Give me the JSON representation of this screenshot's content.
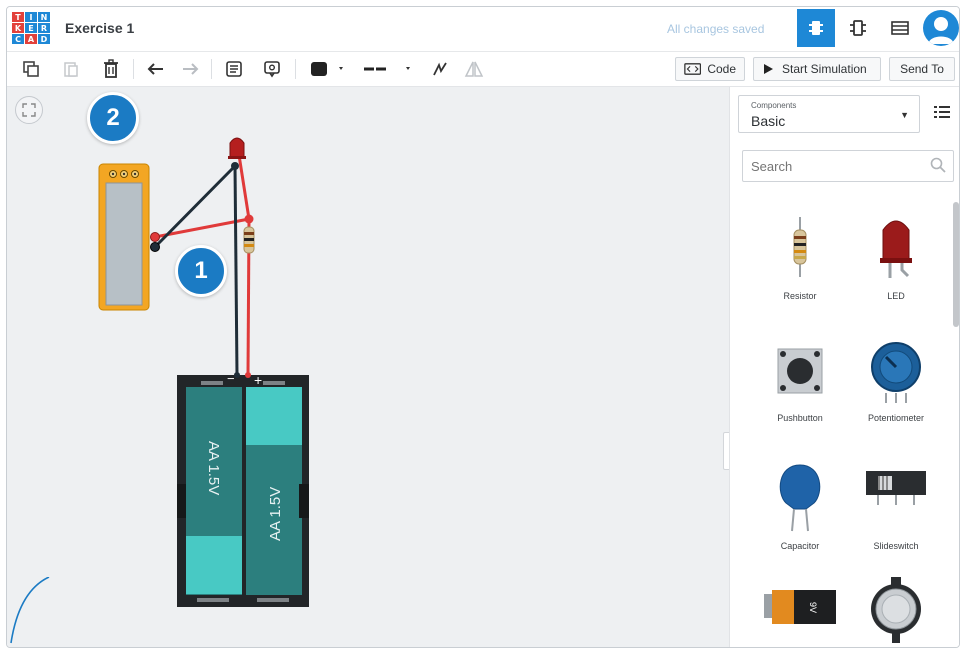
{
  "app": {
    "logo_letters": [
      "T",
      "I",
      "N",
      "K",
      "E",
      "R",
      "C",
      "A",
      "D"
    ],
    "logo_colors": [
      "#e2413b",
      "#1e88d6",
      "#1e88d6",
      "#e2413b",
      "#1e88d6",
      "#1e88d6",
      "#1e88d6",
      "#e2413b",
      "#1e88d6"
    ],
    "title": "Exercise 1",
    "save_status": "All changes saved"
  },
  "header_buttons": [
    {
      "name": "circuit-view-icon",
      "active": true
    },
    {
      "name": "schematic-view-icon",
      "active": false
    },
    {
      "name": "component-list-icon",
      "active": false
    }
  ],
  "toolbar": {
    "code_label": "Code",
    "start_simulation_label": "Start Simulation",
    "send_to_label": "Send To"
  },
  "callouts": [
    "1",
    "2"
  ],
  "canvas": {
    "battery_labels": [
      "AA 1.5V",
      "AA 1.5V"
    ],
    "battery_terminals": [
      "−",
      "+"
    ]
  },
  "panel": {
    "components_small_label": "Components",
    "components_value": "Basic",
    "search_placeholder": "Search",
    "components": [
      {
        "label": "Resistor",
        "icon": "resistor-icon"
      },
      {
        "label": "LED",
        "icon": "led-icon"
      },
      {
        "label": "Pushbutton",
        "icon": "pushbutton-icon"
      },
      {
        "label": "Potentiometer",
        "icon": "potentiometer-icon"
      },
      {
        "label": "Capacitor",
        "icon": "capacitor-icon"
      },
      {
        "label": "Slideswitch",
        "icon": "slideswitch-icon"
      },
      {
        "label": "",
        "icon": "9v-battery-icon",
        "battery_text": "9V"
      },
      {
        "label": "",
        "icon": "coin-cell-battery-icon"
      }
    ]
  },
  "colors": {
    "accent": "#1e88d6",
    "callout": "#1b7bc4",
    "wire_red": "#e03a3a",
    "wire_black": "#1f2d38",
    "battery_teal": "#2c7f7e",
    "battery_light": "#48c9c4",
    "multimeter_orange": "#f3a623"
  }
}
